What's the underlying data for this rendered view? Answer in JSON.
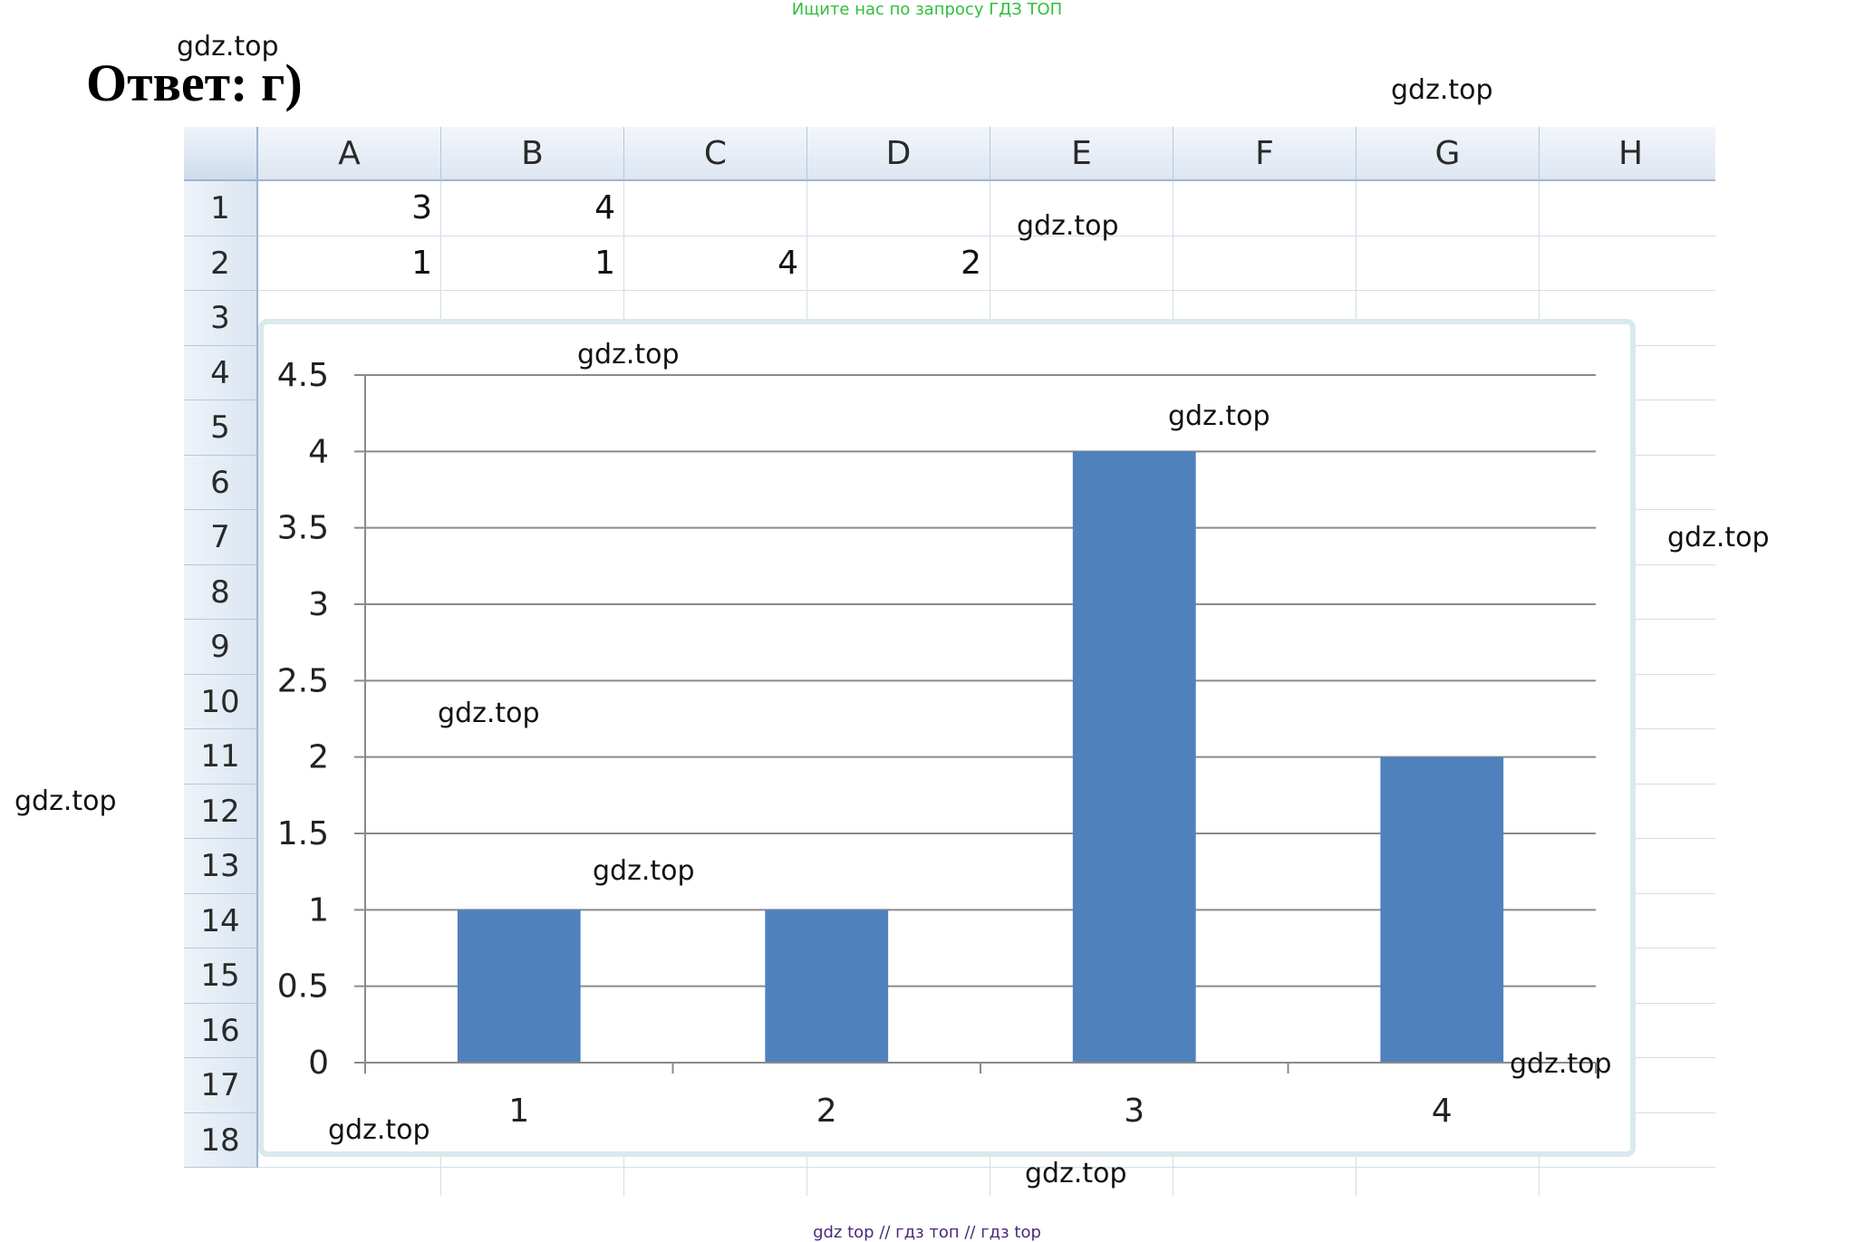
{
  "banner": "Ищите нас по запросу ГДЗ ТОП",
  "answer": "Ответ: г)",
  "watermark": "gdz.top",
  "footer": "gdz top  //  гдз топ  //  гдз top",
  "sheet": {
    "columns": [
      "A",
      "B",
      "C",
      "D",
      "E",
      "F",
      "G",
      "H"
    ],
    "rows": [
      "1",
      "2",
      "3",
      "4",
      "5",
      "6",
      "7",
      "8",
      "9",
      "10",
      "11",
      "12",
      "13",
      "14",
      "15",
      "16",
      "17",
      "18"
    ],
    "row1": [
      "3",
      "4"
    ],
    "row2": [
      "1",
      "1",
      "4",
      "2"
    ]
  },
  "chart_data": {
    "type": "bar",
    "categories": [
      "1",
      "2",
      "3",
      "4"
    ],
    "values": [
      1,
      1,
      4,
      2
    ],
    "ylim": [
      0,
      4.5
    ],
    "yticks": [
      "0",
      "0.5",
      "1",
      "1.5",
      "2",
      "2.5",
      "3",
      "3.5",
      "4",
      "4.5"
    ],
    "bar_color": "#4f81bd",
    "gridlines": true,
    "legend": "none"
  }
}
